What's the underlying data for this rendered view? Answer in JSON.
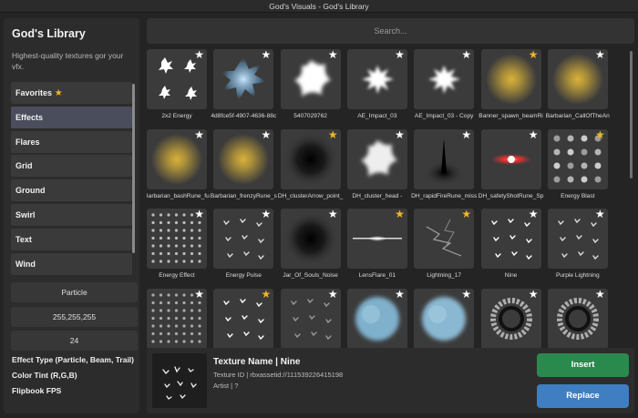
{
  "window": {
    "title": "God's Visuals - God's Library"
  },
  "sidebar": {
    "title": "God's Library",
    "subtitle": "Highest-quality textures gor your vfx.",
    "categories": [
      {
        "label": "Favorites",
        "has_star": true
      },
      {
        "label": "Effects",
        "active": true
      },
      {
        "label": "Flares"
      },
      {
        "label": "Grid"
      },
      {
        "label": "Ground"
      },
      {
        "label": "Swirl"
      },
      {
        "label": "Text"
      },
      {
        "label": "Wind"
      }
    ],
    "effect_type": "Particle",
    "color_tint": "255,255,255",
    "flipbook_fps": "24",
    "labels": {
      "effect_type": "Effect Type (Particle, Beam, Trail)",
      "color_tint": "Color Tint (R,G,B)",
      "flipbook_fps": "Flipbook FPS"
    }
  },
  "search": {
    "placeholder": "Search..."
  },
  "grid": {
    "items": [
      {
        "name": "2x2 Energy",
        "fav": false,
        "art": "burst4",
        "color": "#ffffff"
      },
      {
        "name": "4d8fce5f-4907-4636-88c",
        "fav": false,
        "art": "splash",
        "color": "#c9e6ff"
      },
      {
        "name": "5407029762",
        "fav": false,
        "art": "blob",
        "color": "#ffffff"
      },
      {
        "name": "AE_Impact_03",
        "fav": false,
        "art": "burst",
        "color": "#ffffff"
      },
      {
        "name": "AE_Impact_03 - Copy",
        "fav": false,
        "art": "burst",
        "color": "#ffffff"
      },
      {
        "name": "Banner_spawn_beamRi",
        "fav": true,
        "art": "glow",
        "color": "#d9b23a"
      },
      {
        "name": "Barbarian_CallOfTheAn",
        "fav": false,
        "art": "glow",
        "color": "#4c7a3a"
      },
      {
        "name": "Barbarian_bashRune_fu",
        "fav": false,
        "art": "glow",
        "color": "#ff5a1f"
      },
      {
        "name": "Barbarian_frenzyRune_s",
        "fav": false,
        "art": "glow",
        "color": "#4aa8ff"
      },
      {
        "name": "DH_clusterArrow_point_",
        "fav": true,
        "art": "dark",
        "color": "#151515"
      },
      {
        "name": "DH_cluster_head -",
        "fav": false,
        "art": "blob",
        "color": "#eeeeee"
      },
      {
        "name": "DH_rapidFireRune_miss",
        "fav": false,
        "art": "darkspike",
        "color": "#111111"
      },
      {
        "name": "DH_safetyShotRune_Sp",
        "fav": false,
        "art": "flare",
        "color": "#ff3030"
      },
      {
        "name": "Energy Blast",
        "fav": true,
        "art": "dots",
        "color": "#dddddd"
      },
      {
        "name": "Energy Effect",
        "fav": false,
        "art": "fine-dots",
        "color": "#bbbbbb"
      },
      {
        "name": "Energy Pulse",
        "fav": false,
        "art": "sparks",
        "color": "#dddddd"
      },
      {
        "name": "Jar_Of_Souls_Noise",
        "fav": false,
        "art": "dark",
        "color": "#111111"
      },
      {
        "name": "LensFlare_01",
        "fav": true,
        "art": "lensflare",
        "color": "#ffffff"
      },
      {
        "name": "Lightning_17",
        "fav": true,
        "art": "lightning",
        "color": "#bbbbbb"
      },
      {
        "name": "Nine",
        "fav": false,
        "art": "sparks",
        "color": "#ffffff"
      },
      {
        "name": "Purple Lightning",
        "fav": false,
        "art": "sparks",
        "color": "#dddddd"
      },
      {
        "name": "",
        "fav": false,
        "art": "fine-dots",
        "color": "#aaaaaa"
      },
      {
        "name": "",
        "fav": true,
        "art": "sparks",
        "color": "#ffffff"
      },
      {
        "name": "",
        "fav": false,
        "art": "sparks",
        "color": "#999999"
      },
      {
        "name": "",
        "fav": false,
        "art": "cloud",
        "color": "#7fb0cc"
      },
      {
        "name": "",
        "fav": false,
        "art": "cloud",
        "color": "#8ab8d2"
      },
      {
        "name": "",
        "fav": false,
        "art": "ring",
        "color": "#cccccc"
      },
      {
        "name": "",
        "fav": false,
        "art": "ring",
        "color": "#cccccc"
      }
    ]
  },
  "details": {
    "name": "Texture Name | Nine",
    "id": "Texture ID | rbxassetid://11153922641519​8",
    "artist": "Artist | ?",
    "insert_label": "Insert",
    "replace_label": "Replace"
  }
}
